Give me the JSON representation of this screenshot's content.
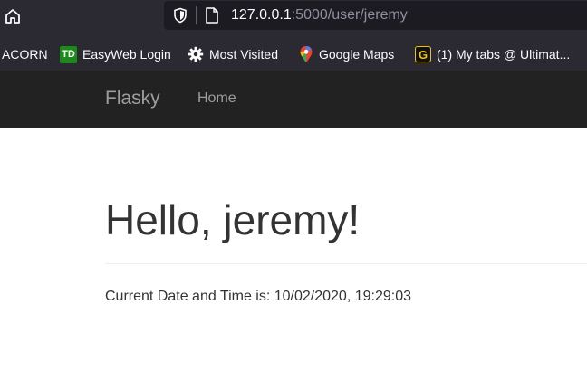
{
  "browser": {
    "url": {
      "host": "127.0.0.1",
      "rest": ":5000/user/jeremy"
    },
    "icons": {
      "home": "home-icon",
      "tracking": "shield-icon",
      "page": "page-icon"
    },
    "bookmarks": [
      {
        "label": "ACORN",
        "icon": ""
      },
      {
        "label": "EasyWeb Login",
        "icon": "td-bank-icon",
        "icon_text": "TD",
        "color": "#1a8a1a"
      },
      {
        "label": "Most Visited",
        "icon": "gear-icon"
      },
      {
        "label": "Google Maps",
        "icon": "google-maps-pin-icon"
      },
      {
        "label": "(1) My tabs @ Ultimat...",
        "icon": "ultimate-guitar-icon",
        "icon_text": "G",
        "color": "#f2c400"
      }
    ]
  },
  "site": {
    "brand": "Flasky",
    "nav": {
      "home": "Home"
    }
  },
  "main": {
    "greeting": "Hello, jeremy!",
    "datetime": "Current Date and Time is: 10/02/2020, 19:29:03"
  },
  "colors": {
    "chrome_bg": "#2b2a33",
    "navbar_bg": "#222222",
    "nav_text": "#9d9d9d",
    "body_text": "#333333"
  }
}
